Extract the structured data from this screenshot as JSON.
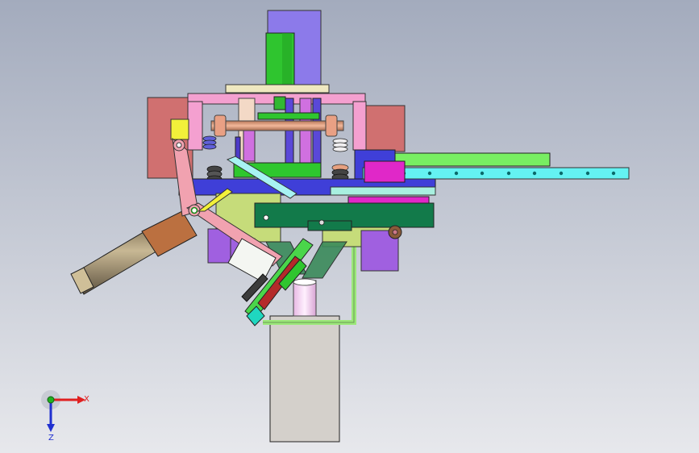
{
  "viewport": {
    "background_top": "#a3abbd",
    "background_bottom": "#e7e8ec"
  },
  "model_parts": [
    "support-pedestal",
    "vertical-motor-housing",
    "spindle-motor",
    "frame-left-block",
    "frame-right-block",
    "top-crossbeam",
    "guide-shaft-assembly",
    "vertical-guide-rods",
    "linear-slide-rail",
    "pivot-lever-arm",
    "pneumatic-cylinder",
    "olive-carriage",
    "dark-green-slide-plate",
    "purple-actuator-blocks",
    "tilted-clamp-assembly",
    "support-bracket-frame",
    "pink-sleeve"
  ],
  "triad": {
    "x_label": "X",
    "z_label": "Z",
    "x_color": "#e02020",
    "y_color": "#20b020",
    "z_color": "#2030d0"
  }
}
